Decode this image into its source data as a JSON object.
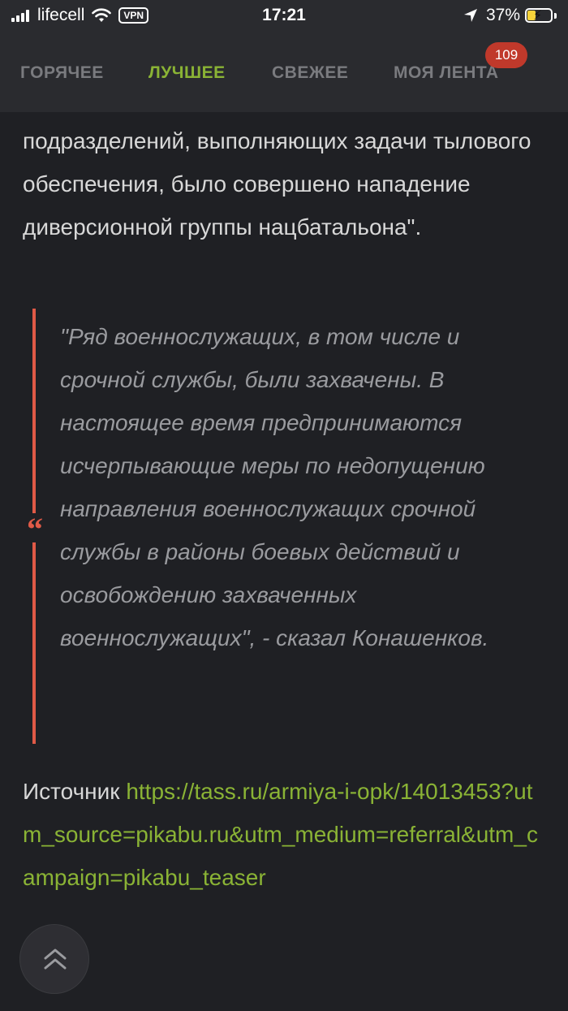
{
  "status_bar": {
    "carrier": "lifecell",
    "vpn": "VPN",
    "time": "17:21",
    "battery_percent": "37%",
    "battery_level": 0.37,
    "battery_color": "#f6d33a"
  },
  "nav": {
    "tabs": [
      {
        "label": "ГОРЯЧЕЕ",
        "active": false
      },
      {
        "label": "ЛУЧШЕЕ",
        "active": true
      },
      {
        "label": "СВЕЖЕЕ",
        "active": false
      },
      {
        "label": "МОЯ ЛЕНТА",
        "active": false
      }
    ],
    "feed_badge": "109",
    "accent_color": "#8ab335",
    "badge_color": "#c0392b"
  },
  "article": {
    "paragraph": "подразделений, выполняющих задачи тылового обеспечения, было совершено нападение диверсионной группы нацбатальона\".",
    "quote_mark": "“",
    "quote": "\"Ряд военнослужащих, в том числе и срочной службы, были захвачены. В настоящее время предпринимаются исчерпывающие меры по недопущению направления военнослужащих срочной службы в районы боевых действий и освобождению захваченных военнослужащих\", - сказал Конашенков.",
    "source_label": "Источник",
    "source_url": "https://tass.ru/armiya-i-opk/14013453?utm_source=pikabu.ru&utm_medium=referral&utm_campaign=pikabu_teaser",
    "quote_bar_color": "#e05a47"
  },
  "scroll_up": {
    "icon": "double-chevron-up-icon"
  }
}
